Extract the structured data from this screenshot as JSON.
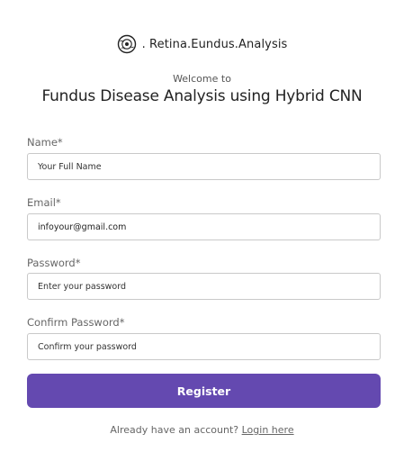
{
  "brand": {
    "logo_icon": "eye-icon",
    "name": ". Retina.Eundus.Analysis"
  },
  "header": {
    "welcome": "Welcome to",
    "title": "Fundus Disease Analysis using Hybrid CNN"
  },
  "form": {
    "name": {
      "label": "Name*",
      "placeholder": "Your Full Name"
    },
    "email": {
      "label": "Email*",
      "value": "infoyour@gmail.com"
    },
    "password": {
      "label": "Password*",
      "placeholder": "Enter your password"
    },
    "confirm_password": {
      "label": "Confirm Password*",
      "placeholder": "Confirm your password"
    },
    "submit_label": "Register"
  },
  "footer": {
    "prompt": "Already have an account? ",
    "login_link": "Login here"
  },
  "colors": {
    "accent": "#6449b0",
    "input_border": "#c9c9c9"
  }
}
